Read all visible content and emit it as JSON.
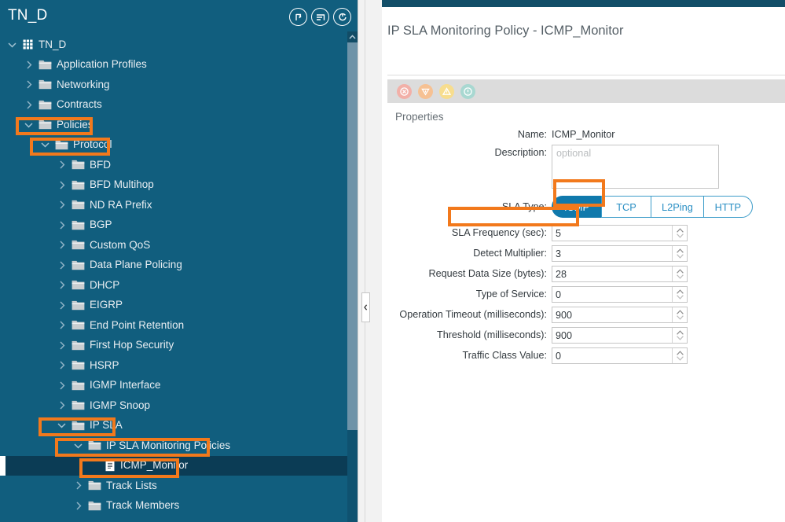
{
  "nav": {
    "title": "TN_D",
    "header_icons": [
      {
        "name": "search-history-icon"
      },
      {
        "name": "filter-list-icon"
      },
      {
        "name": "refresh-icon"
      }
    ],
    "tree": [
      {
        "label": "TN_D",
        "depth": 0,
        "twisty": "down",
        "icon": "tenant-icon",
        "selected": false,
        "highlight": false
      },
      {
        "label": "Application Profiles",
        "depth": 1,
        "twisty": "right",
        "icon": "folder-icon",
        "selected": false,
        "highlight": false
      },
      {
        "label": "Networking",
        "depth": 1,
        "twisty": "right",
        "icon": "folder-icon",
        "selected": false,
        "highlight": false
      },
      {
        "label": "Contracts",
        "depth": 1,
        "twisty": "right",
        "icon": "folder-icon",
        "selected": false,
        "highlight": false
      },
      {
        "label": "Policies",
        "depth": 1,
        "twisty": "down",
        "icon": "folder-icon",
        "selected": false,
        "highlight": true
      },
      {
        "label": "Protocol",
        "depth": 2,
        "twisty": "down",
        "icon": "folder-icon",
        "selected": false,
        "highlight": true
      },
      {
        "label": "BFD",
        "depth": 3,
        "twisty": "right",
        "icon": "folder-icon",
        "selected": false,
        "highlight": false
      },
      {
        "label": "BFD Multihop",
        "depth": 3,
        "twisty": "right",
        "icon": "folder-icon",
        "selected": false,
        "highlight": false
      },
      {
        "label": "ND RA Prefix",
        "depth": 3,
        "twisty": "right",
        "icon": "folder-icon",
        "selected": false,
        "highlight": false
      },
      {
        "label": "BGP",
        "depth": 3,
        "twisty": "right",
        "icon": "folder-icon",
        "selected": false,
        "highlight": false
      },
      {
        "label": "Custom QoS",
        "depth": 3,
        "twisty": "right",
        "icon": "folder-icon",
        "selected": false,
        "highlight": false
      },
      {
        "label": "Data Plane Policing",
        "depth": 3,
        "twisty": "right",
        "icon": "folder-icon",
        "selected": false,
        "highlight": false
      },
      {
        "label": "DHCP",
        "depth": 3,
        "twisty": "right",
        "icon": "folder-icon",
        "selected": false,
        "highlight": false
      },
      {
        "label": "EIGRP",
        "depth": 3,
        "twisty": "right",
        "icon": "folder-icon",
        "selected": false,
        "highlight": false
      },
      {
        "label": "End Point Retention",
        "depth": 3,
        "twisty": "right",
        "icon": "folder-icon",
        "selected": false,
        "highlight": false
      },
      {
        "label": "First Hop Security",
        "depth": 3,
        "twisty": "right",
        "icon": "folder-icon",
        "selected": false,
        "highlight": false
      },
      {
        "label": "HSRP",
        "depth": 3,
        "twisty": "right",
        "icon": "folder-icon",
        "selected": false,
        "highlight": false
      },
      {
        "label": "IGMP Interface",
        "depth": 3,
        "twisty": "right",
        "icon": "folder-icon",
        "selected": false,
        "highlight": false
      },
      {
        "label": "IGMP Snoop",
        "depth": 3,
        "twisty": "right",
        "icon": "folder-icon",
        "selected": false,
        "highlight": false
      },
      {
        "label": "IP SLA",
        "depth": 3,
        "twisty": "down",
        "icon": "folder-icon",
        "selected": false,
        "highlight": true
      },
      {
        "label": "IP SLA Monitoring Policies",
        "depth": 4,
        "twisty": "down",
        "icon": "folder-icon",
        "selected": false,
        "highlight": true
      },
      {
        "label": "ICMP_Monitor",
        "depth": 5,
        "twisty": "none",
        "icon": "policy-doc-icon",
        "selected": true,
        "highlight": true
      },
      {
        "label": "Track Lists",
        "depth": 4,
        "twisty": "right",
        "icon": "folder-icon",
        "selected": false,
        "highlight": false
      },
      {
        "label": "Track Members",
        "depth": 4,
        "twisty": "right",
        "icon": "folder-icon",
        "selected": false,
        "highlight": false
      }
    ]
  },
  "panel": {
    "title": "IP SLA Monitoring Policy - ICMP_Monitor",
    "properties_label": "Properties",
    "status_icons": [
      {
        "name": "error-icon",
        "color": "#f2b0a8"
      },
      {
        "name": "warning-down-icon",
        "color": "#f6c193"
      },
      {
        "name": "alert-triangle-icon",
        "color": "#f7dd8e"
      },
      {
        "name": "info-icon",
        "color": "#a8d8d1"
      }
    ],
    "fields": {
      "name_label": "Name:",
      "name_value": "ICMP_Monitor",
      "description_label": "Description:",
      "description_placeholder": "optional",
      "description_value": "",
      "sla_type_label": "SLA Type:",
      "sla_type_options": [
        "ICMP",
        "TCP",
        "L2Ping",
        "HTTP"
      ],
      "sla_type_selected": "ICMP"
    },
    "numeric_fields": [
      {
        "label": "SLA Frequency (sec):",
        "value": "5",
        "highlight": true
      },
      {
        "label": "Detect Multiplier:",
        "value": "3",
        "highlight": false
      },
      {
        "label": "Request Data Size (bytes):",
        "value": "28",
        "highlight": false
      },
      {
        "label": "Type of Service:",
        "value": "0",
        "highlight": false
      },
      {
        "label": "Operation Timeout (milliseconds):",
        "value": "900",
        "highlight": false
      },
      {
        "label": "Threshold (milliseconds):",
        "value": "900",
        "highlight": false
      },
      {
        "label": "Traffic Class Value:",
        "value": "0",
        "highlight": false
      }
    ]
  },
  "colors": {
    "nav_background": "#115e7e",
    "nav_selected": "#0b3c55",
    "highlight_orange": "#f2791c",
    "accent_blue": "#1079ac",
    "segment_border": "#3c9cc9"
  }
}
